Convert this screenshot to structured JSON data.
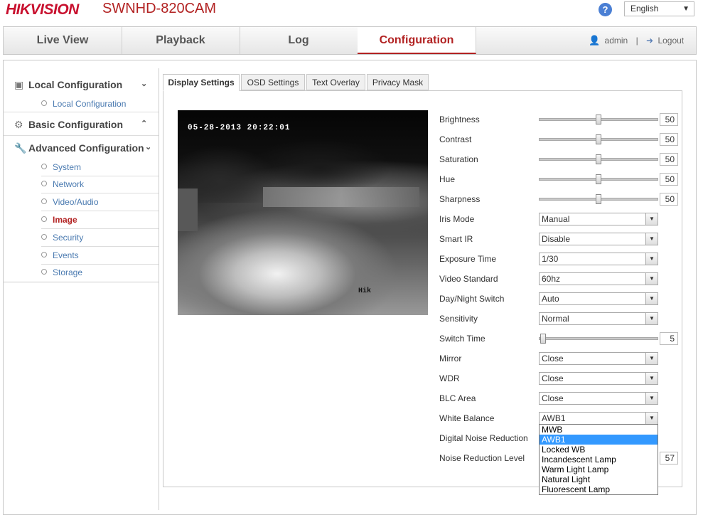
{
  "header": {
    "logo": "HIKVISION",
    "model": "SWNHD-820CAM",
    "help": "?",
    "language": "English"
  },
  "nav": {
    "tabs": [
      {
        "label": "Live View"
      },
      {
        "label": "Playback"
      },
      {
        "label": "Log"
      },
      {
        "label": "Configuration"
      }
    ],
    "user": "admin",
    "separator": "|",
    "logout": "Logout"
  },
  "sidebar": {
    "local_config": "Local Configuration",
    "local_config_sub": "Local Configuration",
    "basic_config": "Basic Configuration",
    "advanced_config": "Advanced Configuration",
    "items": [
      {
        "label": "System"
      },
      {
        "label": "Network"
      },
      {
        "label": "Video/Audio"
      },
      {
        "label": "Image"
      },
      {
        "label": "Security"
      },
      {
        "label": "Events"
      },
      {
        "label": "Storage"
      }
    ]
  },
  "subtabs": [
    {
      "label": "Display Settings"
    },
    {
      "label": "OSD Settings"
    },
    {
      "label": "Text Overlay"
    },
    {
      "label": "Privacy Mask"
    }
  ],
  "video": {
    "timestamp": "05-28-2013 20:22:01",
    "watermark": "Hik"
  },
  "settings": {
    "brightness": {
      "label": "Brightness",
      "value": "50"
    },
    "contrast": {
      "label": "Contrast",
      "value": "50"
    },
    "saturation": {
      "label": "Saturation",
      "value": "50"
    },
    "hue": {
      "label": "Hue",
      "value": "50"
    },
    "sharpness": {
      "label": "Sharpness",
      "value": "50"
    },
    "iris_mode": {
      "label": "Iris Mode",
      "value": "Manual"
    },
    "smart_ir": {
      "label": "Smart IR",
      "value": "Disable"
    },
    "exposure_time": {
      "label": "Exposure Time",
      "value": "1/30"
    },
    "video_standard": {
      "label": "Video Standard",
      "value": "60hz"
    },
    "day_night": {
      "label": "Day/Night Switch",
      "value": "Auto"
    },
    "sensitivity": {
      "label": "Sensitivity",
      "value": "Normal"
    },
    "switch_time": {
      "label": "Switch Time",
      "value": "5"
    },
    "mirror": {
      "label": "Mirror",
      "value": "Close"
    },
    "wdr": {
      "label": "WDR",
      "value": "Close"
    },
    "blc_area": {
      "label": "BLC Area",
      "value": "Close"
    },
    "white_balance": {
      "label": "White Balance",
      "value": "AWB1"
    },
    "dnr": {
      "label": "Digital Noise Reduction"
    },
    "nr_level": {
      "label": "Noise Reduction Level",
      "value": "57"
    }
  },
  "wb_options": [
    "MWB",
    "AWB1",
    "Locked WB",
    "Incandescent Lamp",
    "Warm Light Lamp",
    "Natural Light",
    "Fluorescent Lamp"
  ]
}
